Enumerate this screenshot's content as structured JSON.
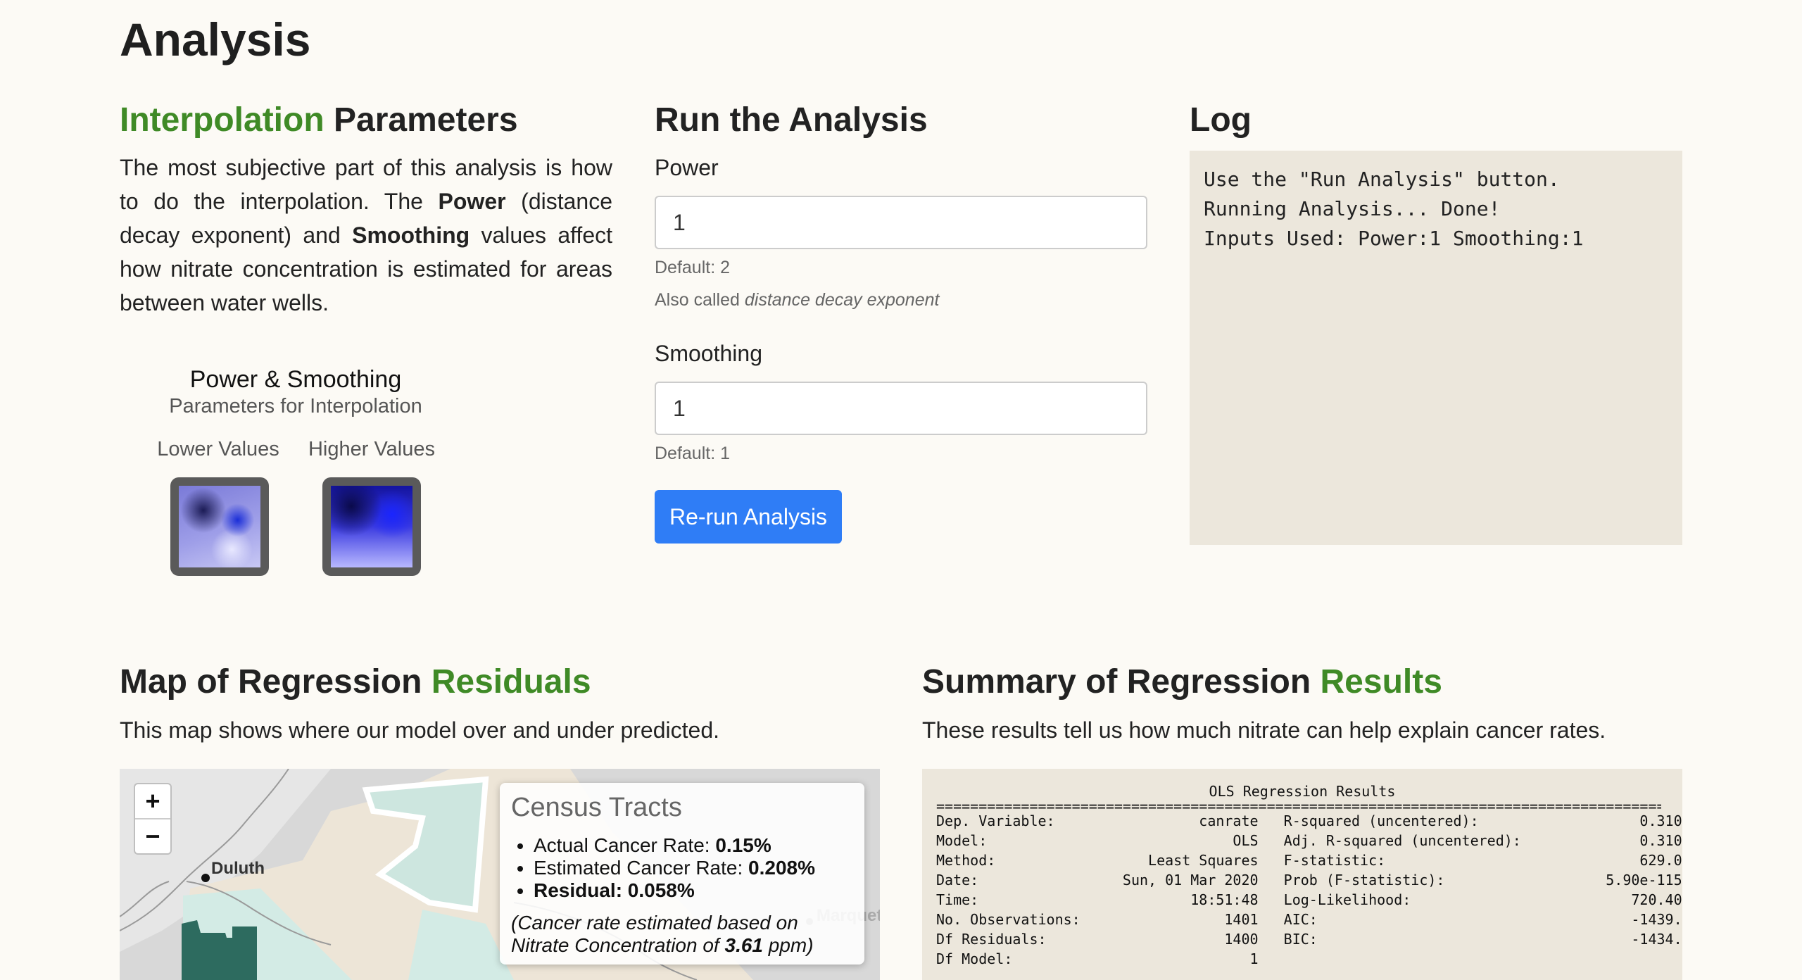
{
  "page_title": "Analysis",
  "interpolation": {
    "heading_accent": "Interpolation",
    "heading_rest": "Parameters",
    "intro_1": "The most subjective part of this analysis is how to do the interpolation. The",
    "power_word": "Power",
    "intro_2": "(distance decay exponent) and",
    "smoothing_word": "Smoothing",
    "intro_3": "values affect how nitrate concentration is estimated for areas between water wells.",
    "figure": {
      "title": "Power & Smoothing",
      "subtitle": "Parameters for Interpolation",
      "lower_label": "Lower Values",
      "higher_label": "Higher Values"
    }
  },
  "run": {
    "heading": "Run the Analysis",
    "power": {
      "label": "Power",
      "value": "1",
      "default_text": "Default: 2",
      "alias_prefix": "Also called",
      "alias_term": "distance decay exponent"
    },
    "smoothing": {
      "label": "Smoothing",
      "value": "1",
      "default_text": "Default: 1"
    },
    "button_label": "Re-run Analysis"
  },
  "log": {
    "heading": "Log",
    "lines": [
      "Use the \"Run Analysis\" button.",
      "",
      "Running Analysis... Done!",
      "Inputs Used: Power:1 Smoothing:1"
    ]
  },
  "map_section": {
    "heading_rest": "Map of Regression",
    "heading_accent": "Residuals",
    "description": "This map shows where our model over and under predicted.",
    "zoom_in": "+",
    "zoom_out": "−",
    "city_duluth": "Duluth",
    "city_marquette": "Marquet",
    "info": {
      "title": "Census Tracts",
      "actual_label": "Actual Cancer Rate:",
      "actual_value": "0.15%",
      "estimated_label": "Estimated Cancer Rate:",
      "estimated_value": "0.208%",
      "residual": "Residual: 0.058%",
      "note_prefix": "(Cancer rate estimated based on Nitrate Concentration of",
      "note_value": "3.61",
      "note_suffix": "ppm)"
    }
  },
  "summary_section": {
    "heading_rest": "Summary of Regression",
    "heading_accent": "Results",
    "description": "These results tell us how much nitrate can help explain cancer rates.",
    "table_title": "OLS Regression Results",
    "divider": "=======================================================================================",
    "rows": [
      "Dep. Variable:                 canrate   R-squared (uncentered):                   0.310",
      "Model:                             OLS   Adj. R-squared (uncentered):              0.310",
      "Method:                  Least Squares   F-statistic:                              629.0",
      "Date:                 Sun, 01 Mar 2020   Prob (F-statistic):                   5.90e-115",
      "Time:                         18:51:48   Log-Likelihood:                          720.40",
      "No. Observations:                 1401   AIC:                                     -1439.",
      "Df Residuals:                     1400   BIC:                                     -1434.",
      "Df Model:                            1"
    ]
  }
}
